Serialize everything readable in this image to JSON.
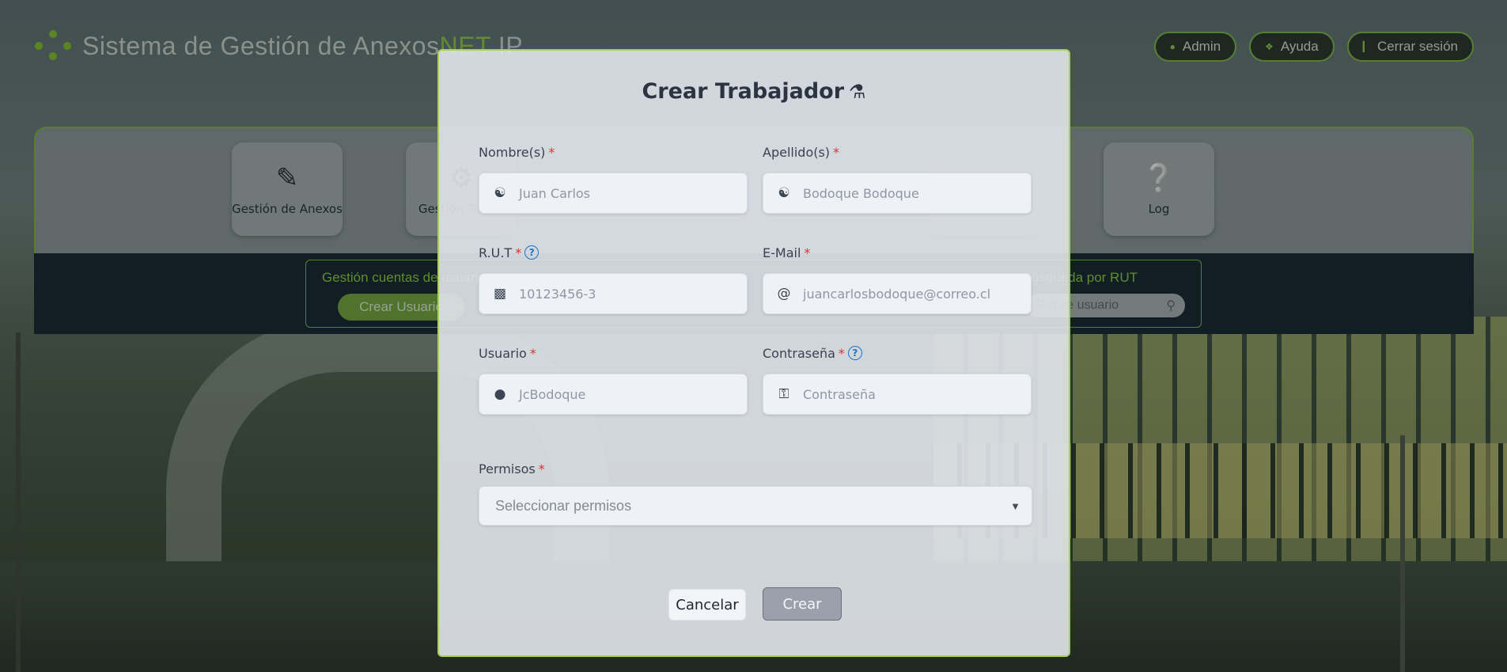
{
  "header": {
    "title": "Sistema de Gestión de Anexos",
    "title_suffix_net": "NET",
    "title_suffix_ip": "IP",
    "buttons": [
      {
        "label": "Admin",
        "icon": "user-icon"
      },
      {
        "label": "Ayuda",
        "icon": "help-icon"
      },
      {
        "label": "Cerrar sesión",
        "icon": "logout-icon"
      }
    ]
  },
  "nav": {
    "cards": [
      {
        "label": "Gestión de Anexos",
        "icon": "notes-icon"
      },
      {
        "label": "Gestión Trab...",
        "icon": "users-gear-icon"
      },
      {
        "label": "Log",
        "icon": "question-circle-icon"
      }
    ],
    "accounts_title": "Gestión cuentas de usuario",
    "create_user_button": "Crear Usuario",
    "rut_search_title": "Búsqueda por RUT",
    "rut_search_placeholder": "Rut de usuario"
  },
  "modal": {
    "title": "Crear Trabajador",
    "title_icon": "flask-icon",
    "required_mark": "*",
    "fields": {
      "nombre": {
        "label": "Nombre(s)",
        "placeholder": "Juan Carlos",
        "icon": "user-secret-icon"
      },
      "apellido": {
        "label": "Apellido(s)",
        "placeholder": "Bodoque Bodoque",
        "icon": "user-secret-icon"
      },
      "rut": {
        "label": "R.U.T",
        "placeholder": "10123456-3",
        "icon": "id-card-icon",
        "help": "?"
      },
      "email": {
        "label": "E-Mail",
        "placeholder": "juancarlosbodoque@correo.cl",
        "icon": "at-icon"
      },
      "usuario": {
        "label": "Usuario",
        "placeholder": "JcBodoque",
        "icon": "user-icon"
      },
      "contrasena": {
        "label": "Contraseña",
        "placeholder": "Contraseña",
        "icon": "lock-icon",
        "help": "?"
      }
    },
    "permisos": {
      "label": "Permisos",
      "placeholder": "Seleccionar permisos"
    },
    "cancel_button": "Cancelar",
    "create_button": "Crear"
  },
  "colors": {
    "accent_green": "#7cb342",
    "required_red": "#d9342b",
    "help_blue": "#1f72c8",
    "modal_title": "#2c3442"
  }
}
